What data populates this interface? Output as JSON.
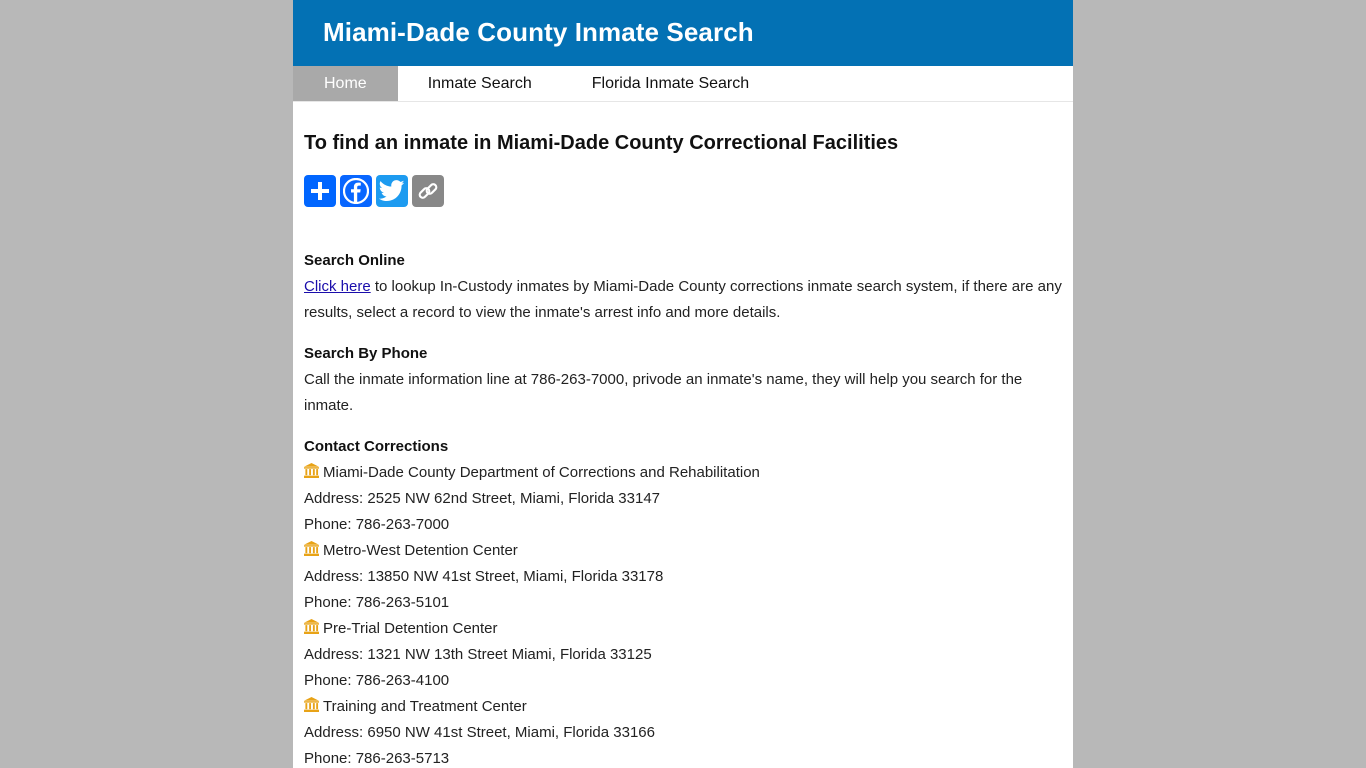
{
  "header": {
    "title": "Miami-Dade County Inmate Search"
  },
  "nav": {
    "items": [
      {
        "label": "Home"
      },
      {
        "label": "Inmate Search"
      },
      {
        "label": "Florida Inmate Search"
      }
    ]
  },
  "main": {
    "heading": "To find an inmate in Miami-Dade County Correctional Facilities",
    "share": {
      "icons": [
        "add-icon",
        "facebook-icon",
        "twitter-icon",
        "copy-link-icon"
      ]
    },
    "search_online": {
      "title": "Search Online",
      "link_text": "Click here",
      "text": " to lookup In-Custody inmates by Miami-Dade County corrections inmate search system, if there are any results, select a record to view the inmate's arrest info and more details."
    },
    "search_phone": {
      "title": "Search By Phone",
      "text": "Call the inmate information line at 786-263-7000, privode an inmate's name, they will help you search for the inmate."
    },
    "contact": {
      "title": "Contact Corrections",
      "facilities": [
        {
          "name": "Miami-Dade County Department of Corrections and Rehabilitation",
          "address": "Address: 2525 NW 62nd Street, Miami, Florida 33147",
          "phone": "Phone: 786-263-7000"
        },
        {
          "name": "Metro-West Detention Center",
          "address": "Address: 13850 NW 41st Street, Miami, Florida 33178",
          "phone": "Phone: 786-263-5101"
        },
        {
          "name": "Pre-Trial Detention Center",
          "address": "Address: 1321 NW 13th Street Miami, Florida 33125",
          "phone": "Phone: 786-263-4100"
        },
        {
          "name": "Training and Treatment Center",
          "address": "Address: 6950 NW 41st Street, Miami, Florida 33166",
          "phone": "Phone: 786-263-5713"
        }
      ]
    }
  },
  "colors": {
    "banner": "#0371b4",
    "nav_active": "#a9a9a9",
    "icon_building": "#e8a317",
    "link": "#1a0dab"
  }
}
